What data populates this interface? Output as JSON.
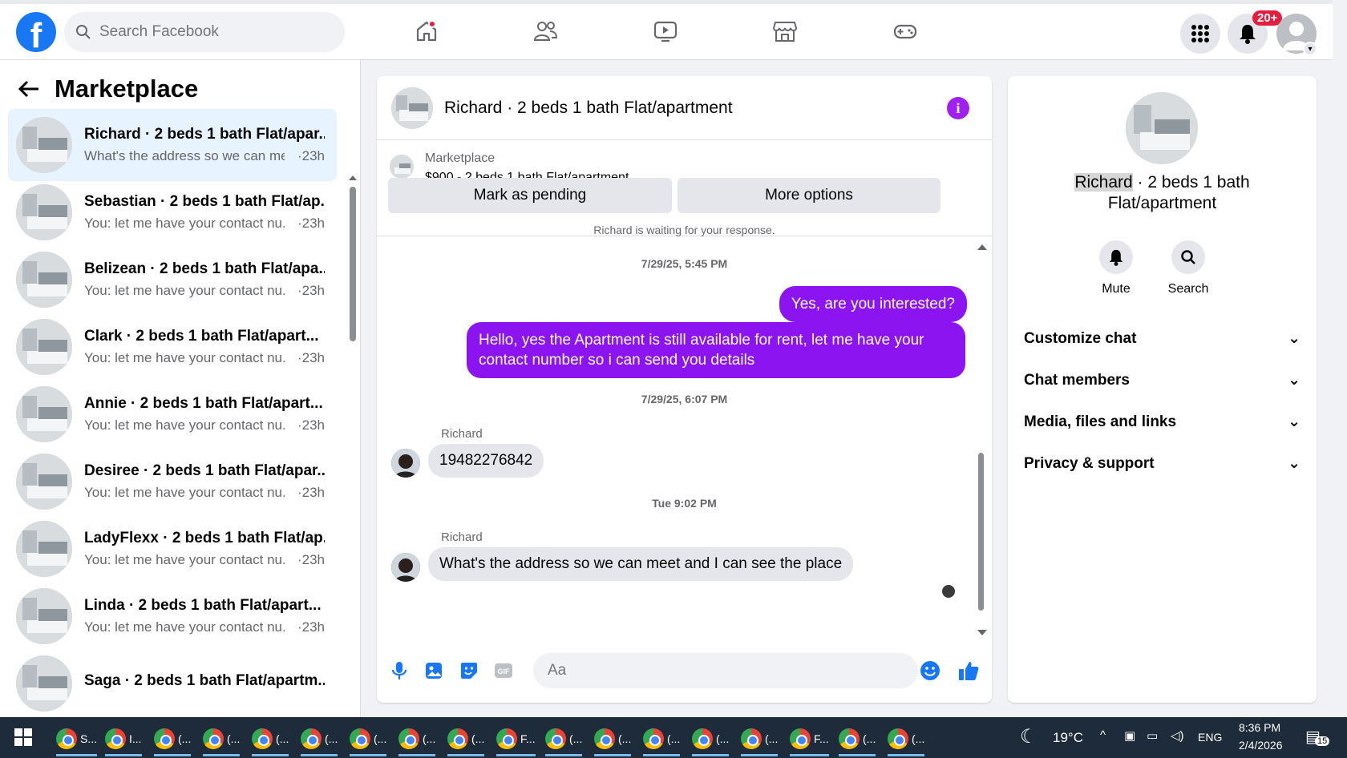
{
  "header": {
    "search_placeholder": "Search Facebook",
    "notif_count": "20+"
  },
  "left": {
    "title": "Marketplace",
    "conversations": [
      {
        "title": "Richard · 2 beds 1 bath Flat/apar...",
        "preview": "What's the address so we can me...",
        "time": "·23h",
        "active": true
      },
      {
        "title": "Sebastian · 2 beds 1 bath Flat/ap...",
        "preview": "You: let me have your contact nu...",
        "time": "·23h"
      },
      {
        "title": "Belizean · 2 beds 1 bath Flat/apa...",
        "preview": "You: let me have your contact nu...",
        "time": "·23h"
      },
      {
        "title": "Clark · 2 beds 1 bath Flat/apart...",
        "preview": "You: let me have your contact nu...",
        "time": "·23h"
      },
      {
        "title": "Annie · 2 beds 1 bath Flat/apart...",
        "preview": "You: let me have your contact nu...",
        "time": "·23h"
      },
      {
        "title": "Desiree · 2 beds 1 bath Flat/apar...",
        "preview": "You: let me have your contact nu...",
        "time": "·23h"
      },
      {
        "title": "LadyFlexx · 2 beds 1 bath Flat/ap...",
        "preview": "You: let me have your contact nu...",
        "time": "·23h"
      },
      {
        "title": "Linda · 2 beds 1 bath Flat/apart...",
        "preview": "You: let me have your contact nu...",
        "time": "·23h"
      },
      {
        "title": "Saga · 2 beds 1 bath Flat/apartm...",
        "preview": "",
        "time": ""
      }
    ]
  },
  "chat": {
    "title": "Richard · 2 beds 1 bath Flat/apartment",
    "marketplace_label": "Marketplace",
    "listing": "$900 - 2 beds 1 bath Flat/apartment",
    "mark_pending": "Mark as pending",
    "more_options": "More options",
    "waiting": "Richard is waiting for your response.",
    "ts1": "7/29/25, 5:45 PM",
    "out1": "Yes, are you interested?",
    "out2": "Hello, yes the Apartment is still available for rent, let me have your contact number so i can send you details",
    "ts2": "7/29/25, 6:07 PM",
    "sender1": "Richard",
    "in1": "19482276842",
    "ts3": "Tue 9:02 PM",
    "sender2": "Richard",
    "in2": "What's the address so we can meet  and I can see the place",
    "composer_placeholder": "Aa"
  },
  "right": {
    "name_highlight": "Richard",
    "title_rest": " · 2 beds 1 bath",
    "title_line2": "Flat/apartment",
    "mute": "Mute",
    "search": "Search",
    "sections": [
      "Customize chat",
      "Chat members",
      "Media, files and links",
      "Privacy & support"
    ]
  },
  "taskbar": {
    "items": [
      "S...",
      "I...",
      "(...",
      "(...",
      "(...",
      "(...",
      "(...",
      "(...",
      "(...",
      "F...",
      "(...",
      "(...",
      "(...",
      "(...",
      "(...",
      "F...",
      "(...",
      "(..."
    ],
    "weather": "19°C",
    "lang": "ENG",
    "time": "8:36 PM",
    "date": "2/4/2026",
    "notif": "15"
  }
}
